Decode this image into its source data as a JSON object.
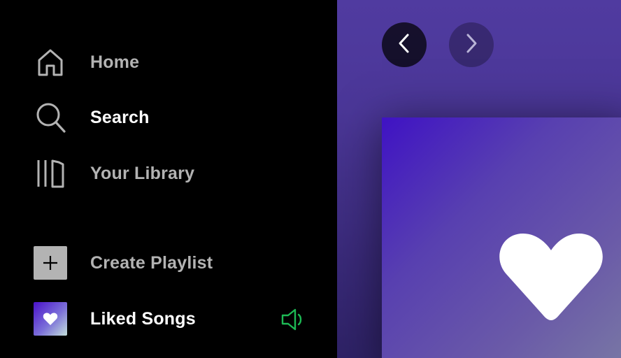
{
  "sidebar": {
    "nav": {
      "home": {
        "label": "Home",
        "icon": "home-icon"
      },
      "search": {
        "label": "Search",
        "icon": "search-icon"
      },
      "library": {
        "label": "Your Library",
        "icon": "library-icon"
      }
    },
    "playlists": {
      "create": {
        "label": "Create Playlist",
        "icon": "plus-icon"
      },
      "liked": {
        "label": "Liked Songs",
        "icon": "heart-icon",
        "playing_icon": "speaker-icon"
      }
    }
  },
  "main": {
    "back_icon": "chevron-left-icon",
    "forward_icon": "chevron-right-icon",
    "cover_icon": "heart-icon"
  },
  "colors": {
    "background": "#000000",
    "text_inactive": "#b3b3b3",
    "text_active": "#ffffff",
    "accent_green": "#1db954",
    "main_gradient_top": "#503ba0"
  }
}
